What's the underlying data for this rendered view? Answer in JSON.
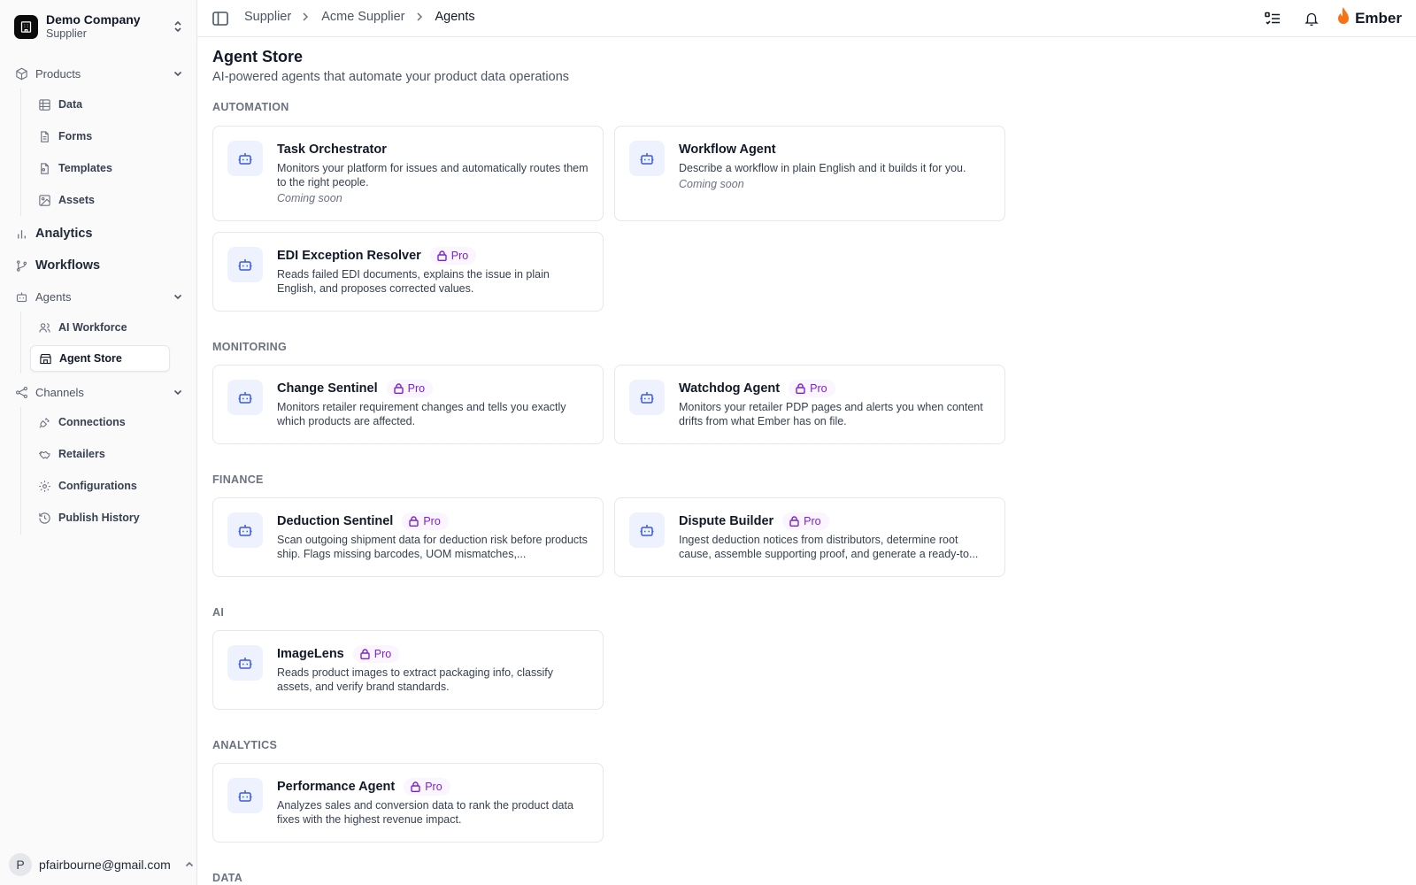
{
  "company": {
    "name": "Demo Company",
    "role": "Supplier"
  },
  "sidebar": {
    "products": {
      "label": "Products",
      "items": [
        {
          "label": "Data",
          "icon": "table-icon"
        },
        {
          "label": "Forms",
          "icon": "file-icon"
        },
        {
          "label": "Templates",
          "icon": "template-icon"
        },
        {
          "label": "Assets",
          "icon": "image-icon"
        }
      ]
    },
    "analytics": {
      "label": "Analytics"
    },
    "workflows": {
      "label": "Workflows"
    },
    "agents": {
      "label": "Agents",
      "items": [
        {
          "label": "AI Workforce",
          "icon": "users-icon"
        },
        {
          "label": "Agent Store",
          "icon": "store-icon",
          "active": true
        }
      ]
    },
    "channels": {
      "label": "Channels",
      "items": [
        {
          "label": "Connections",
          "icon": "plug-icon"
        },
        {
          "label": "Retailers",
          "icon": "handshake-icon"
        },
        {
          "label": "Configurations",
          "icon": "gear-icon"
        },
        {
          "label": "Publish History",
          "icon": "history-icon"
        }
      ]
    }
  },
  "user": {
    "initial": "P",
    "email": "pfairbourne@gmail.com"
  },
  "breadcrumb": [
    "Supplier",
    "Acme Supplier",
    "Agents"
  ],
  "brand": {
    "name": "Ember",
    "color": "#f97316"
  },
  "page": {
    "title": "Agent Store",
    "subtitle": "AI-powered agents that automate your product data operations"
  },
  "badge_label": "Pro",
  "sections": {
    "automation": {
      "label": "AUTOMATION",
      "cards": [
        {
          "title": "Task Orchestrator",
          "desc": "Monitors your platform for issues and automatically routes them to the right people.",
          "status": "Coming soon"
        },
        {
          "title": "Workflow Agent",
          "desc": "Describe a workflow in plain English and it builds it for you.",
          "status": "Coming soon"
        },
        {
          "title": "EDI Exception Resolver",
          "desc": "Reads failed EDI documents, explains the issue in plain English, and proposes corrected values.",
          "pro": true
        }
      ]
    },
    "monitoring": {
      "label": "MONITORING",
      "cards": [
        {
          "title": "Change Sentinel",
          "desc": "Monitors retailer requirement changes and tells you exactly which products are affected.",
          "pro": true
        },
        {
          "title": "Watchdog Agent",
          "desc": "Monitors your retailer PDP pages and alerts you when content drifts from what Ember has on file.",
          "pro": true
        }
      ]
    },
    "finance": {
      "label": "FINANCE",
      "cards": [
        {
          "title": "Deduction Sentinel",
          "desc": "Scan outgoing shipment data for deduction risk before products ship. Flags missing barcodes, UOM mismatches,...",
          "pro": true
        },
        {
          "title": "Dispute Builder",
          "desc": "Ingest deduction notices from distributors, determine root cause, assemble supporting proof, and generate a ready-to...",
          "pro": true
        }
      ]
    },
    "ai": {
      "label": "AI",
      "cards": [
        {
          "title": "ImageLens",
          "desc": "Reads product images to extract packaging info, classify assets, and verify brand standards.",
          "pro": true
        }
      ]
    },
    "analytics": {
      "label": "ANALYTICS",
      "cards": [
        {
          "title": "Performance Agent",
          "desc": "Analyzes sales and conversion data to rank the product data fixes with the highest revenue impact.",
          "pro": true
        }
      ]
    },
    "data": {
      "label": "DATA"
    }
  }
}
